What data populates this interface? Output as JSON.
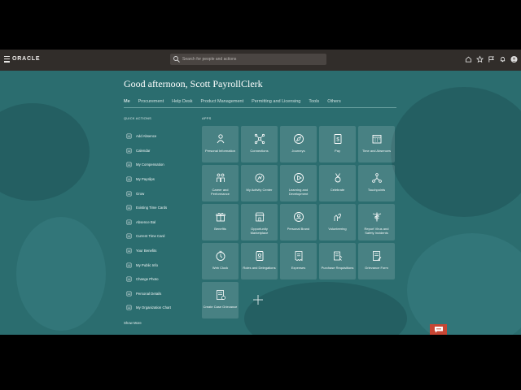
{
  "header": {
    "brand": "ORACLE",
    "search_placeholder": "Search for people and actions"
  },
  "greeting": "Good afternoon, Scott PayrollClerk",
  "tabs": [
    "Me",
    "Procurement",
    "Help Desk",
    "Product Management",
    "Permitting and Licensing",
    "Tools",
    "Others"
  ],
  "quick_actions": {
    "heading": "QUICK ACTIONS",
    "items": [
      "Add Absence",
      "Calendar",
      "My Compensation",
      "My Payslips",
      "Grow",
      "Existing Time Cards",
      "Absence Bal",
      "Current Time Card",
      "Your Benefits",
      "My Public Info",
      "Change Photo",
      "Personal Details",
      "My Organization Chart"
    ],
    "show_more": "Show More"
  },
  "apps": {
    "heading": "APPS",
    "tiles": [
      {
        "label": "Personal Information",
        "icon": "person-icon"
      },
      {
        "label": "Connections",
        "icon": "network-icon"
      },
      {
        "label": "Journeys",
        "icon": "compass-icon"
      },
      {
        "label": "Pay",
        "icon": "money-icon"
      },
      {
        "label": "Time and Absences",
        "icon": "calendar-icon"
      },
      {
        "label": "Career and Performance",
        "icon": "career-icon"
      },
      {
        "label": "My Activity Center",
        "icon": "activity-icon"
      },
      {
        "label": "Learning and Development",
        "icon": "play-icon"
      },
      {
        "label": "Celebrate",
        "icon": "medal-icon"
      },
      {
        "label": "Touchpoints",
        "icon": "touchpoints-icon"
      },
      {
        "label": "Benefits",
        "icon": "gift-icon"
      },
      {
        "label": "Opportunity Marketplace",
        "icon": "store-icon"
      },
      {
        "label": "Personal Brand",
        "icon": "brand-icon"
      },
      {
        "label": "Volunteering",
        "icon": "volunteer-icon"
      },
      {
        "label": "Report Virus and Safety Incidents",
        "icon": "caduceus-icon"
      },
      {
        "label": "Web Clock",
        "icon": "clock-icon"
      },
      {
        "label": "Roles and Delegations",
        "icon": "badge-icon"
      },
      {
        "label": "Expenses",
        "icon": "receipt-icon"
      },
      {
        "label": "Purchase Requisitions",
        "icon": "requisition-icon"
      },
      {
        "label": "Grievance Form",
        "icon": "form-icon"
      },
      {
        "label": "Create Case Grievance",
        "icon": "case-icon"
      }
    ]
  }
}
